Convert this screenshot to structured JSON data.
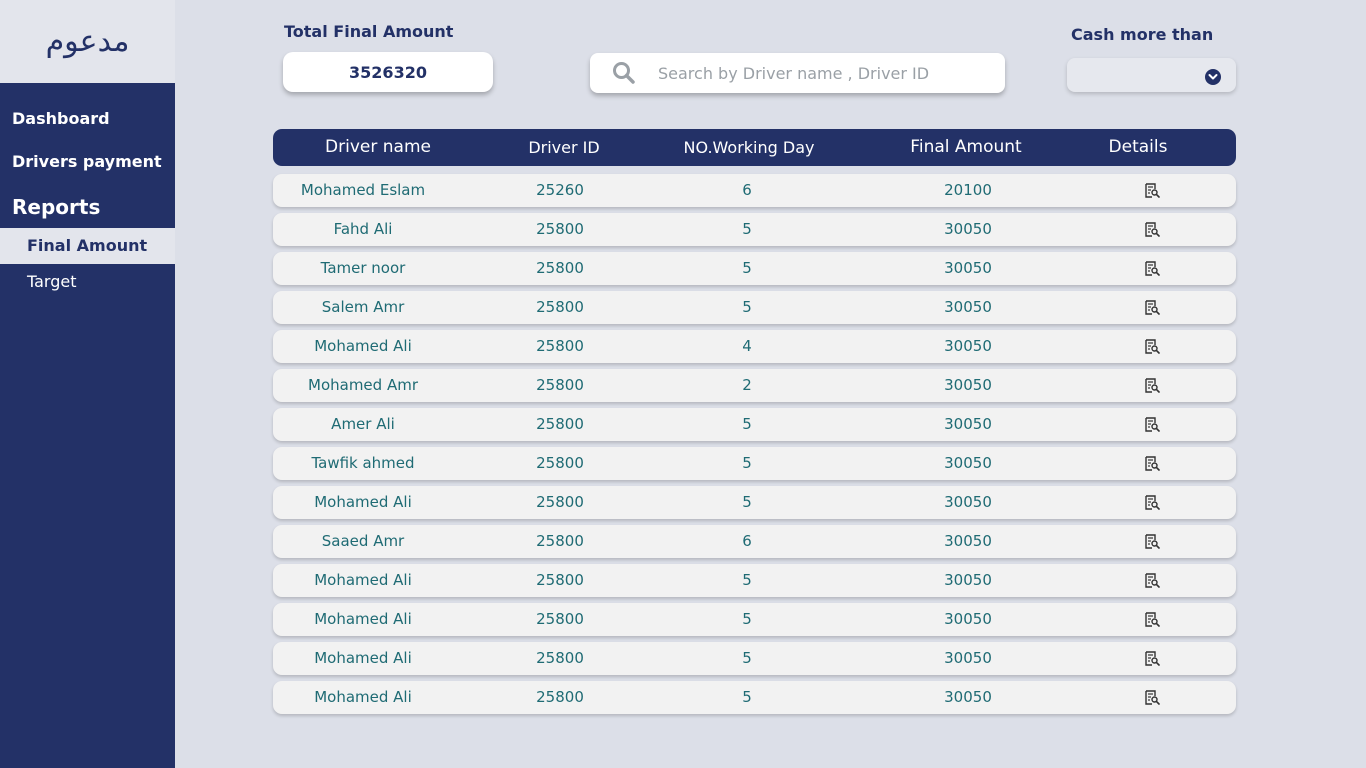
{
  "sidebar": {
    "logo": "مدعوم",
    "items": {
      "dashboard": "Dashboard",
      "drivers_payment": "Drivers payment",
      "reports": "Reports"
    },
    "sub_items": [
      "Final Amount",
      "Target"
    ],
    "active_sub_item": "Final Amount"
  },
  "total": {
    "label": "Total Final Amount",
    "value": "3526320"
  },
  "search": {
    "placeholder": "Search by Driver name , Driver ID",
    "value": ""
  },
  "cash_filter": {
    "label": "Cash more than",
    "value": ""
  },
  "table": {
    "columns": [
      "Driver name",
      "Driver ID",
      "NO.Working Day",
      "Final Amount",
      "Details"
    ],
    "rows": [
      {
        "name": "Mohamed Eslam",
        "id": "25260",
        "days": "6",
        "amount": "20100"
      },
      {
        "name": "Fahd Ali",
        "id": "25800",
        "days": "5",
        "amount": "30050"
      },
      {
        "name": "Tamer noor",
        "id": "25800",
        "days": "5",
        "amount": "30050"
      },
      {
        "name": "Salem Amr",
        "id": "25800",
        "days": "5",
        "amount": "30050"
      },
      {
        "name": "Mohamed Ali",
        "id": "25800",
        "days": "4",
        "amount": "30050"
      },
      {
        "name": "Mohamed Amr",
        "id": "25800",
        "days": "2",
        "amount": "30050"
      },
      {
        "name": "Amer Ali",
        "id": "25800",
        "days": "5",
        "amount": "30050"
      },
      {
        "name": "Tawfik ahmed",
        "id": "25800",
        "days": "5",
        "amount": "30050"
      },
      {
        "name": "Mohamed Ali",
        "id": "25800",
        "days": "5",
        "amount": "30050"
      },
      {
        "name": "Saaed Amr",
        "id": "25800",
        "days": "6",
        "amount": "30050"
      },
      {
        "name": "Mohamed Ali",
        "id": "25800",
        "days": "5",
        "amount": "30050"
      },
      {
        "name": "Mohamed Ali",
        "id": "25800",
        "days": "5",
        "amount": "30050"
      },
      {
        "name": "Mohamed Ali",
        "id": "25800",
        "days": "5",
        "amount": "30050"
      },
      {
        "name": "Mohamed Ali",
        "id": "25800",
        "days": "5",
        "amount": "30050"
      }
    ],
    "details_icon": "document-search-icon"
  },
  "colors": {
    "navy": "#233167",
    "background": "#dcdfe8",
    "row_text": "#1f6b74",
    "row_bg": "#f2f2f2"
  }
}
